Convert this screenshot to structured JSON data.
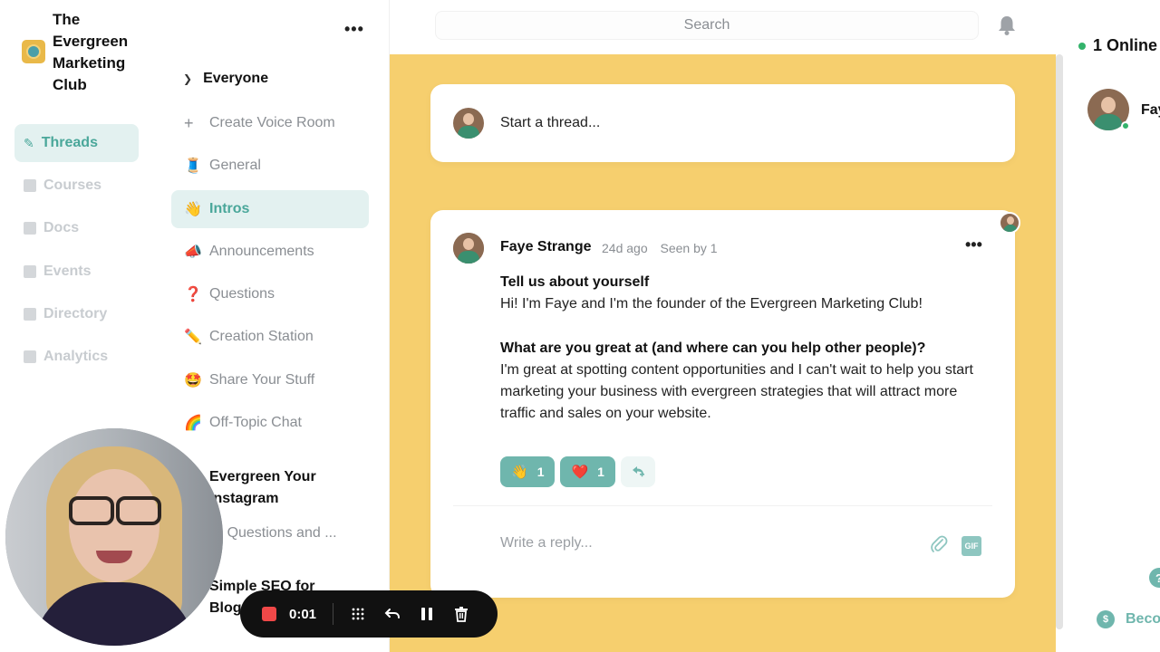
{
  "club": {
    "name": "The Evergreen Marketing Club"
  },
  "nav": {
    "items": [
      {
        "label": "Threads",
        "icon": "leaf-icon",
        "active": true
      },
      {
        "label": "Courses",
        "icon": "book-icon",
        "active": false
      },
      {
        "label": "Docs",
        "icon": "doc-icon",
        "active": false
      },
      {
        "label": "Events",
        "icon": "calendar-icon",
        "active": false
      },
      {
        "label": "Directory",
        "icon": "directory-icon",
        "active": false
      },
      {
        "label": "Analytics",
        "icon": "analytics-icon",
        "active": false
      }
    ]
  },
  "channels": {
    "more": "•••",
    "section": "Everyone",
    "create_voice": "Create Voice Room",
    "create_voice_icon": "+",
    "items": [
      {
        "emoji": "🧵",
        "label": "General"
      },
      {
        "emoji": "👋",
        "label": "Intros"
      },
      {
        "emoji": "📣",
        "label": "Announcements"
      },
      {
        "emoji": "❓",
        "label": "Questions"
      },
      {
        "emoji": "✏️",
        "label": "Creation Station"
      },
      {
        "emoji": "🤩",
        "label": "Share Your Stuff"
      },
      {
        "emoji": "🌈",
        "label": "Off-Topic Chat"
      }
    ],
    "group1": {
      "title": "Evergreen Your Instagram",
      "sub": "YI Questions and ..."
    },
    "group2": {
      "title": "Simple SEO for Blog"
    }
  },
  "topbar": {
    "search_placeholder": "Search"
  },
  "composer": {
    "placeholder": "Start a thread..."
  },
  "post": {
    "author": "Faye Strange",
    "time": "24d ago",
    "seen": "Seen by 1",
    "more": "•••",
    "q1": "Tell us about yourself",
    "a1": "Hi! I'm Faye and I'm the founder of the Evergreen Marketing Club!",
    "q2": "What are you great at (and where can you help other people)?",
    "a2": "I'm great at spotting content opportunities and I can't wait to help you start marketing your business with evergreen strategies that will attract more traffic and sales on your website.",
    "reactions": [
      {
        "emoji": "👋",
        "count": "1"
      },
      {
        "emoji": "❤️",
        "count": "1"
      }
    ],
    "reply_placeholder": "Write a reply...",
    "gif_label": "GIF"
  },
  "right": {
    "online": "1 Online",
    "member_name": "Faye",
    "help": "?",
    "become": "Beco"
  },
  "recorder": {
    "time": "0:01"
  },
  "colors": {
    "accent": "#4aa79a",
    "main_bg": "#f6cf6e",
    "record": "#f04848"
  }
}
